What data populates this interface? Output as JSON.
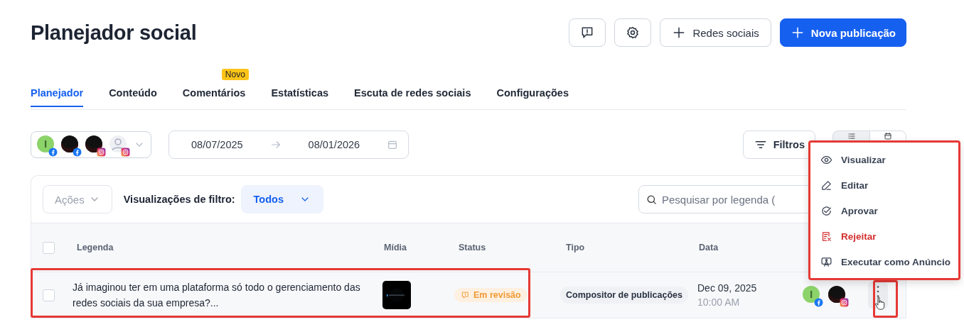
{
  "page": {
    "title": "Planejador social"
  },
  "header_buttons": [
    {
      "kind": "feedback"
    },
    {
      "kind": "settings"
    },
    {
      "kind": "outline",
      "label": "Redes sociais"
    },
    {
      "kind": "primary",
      "label": "Nova publicação"
    }
  ],
  "tabs": [
    {
      "label": "Planejador",
      "selected": true
    },
    {
      "label": "Conteúdo",
      "selected": false
    },
    {
      "label": "Comentários",
      "selected": false,
      "badge": "Novo"
    },
    {
      "label": "Estatísticas",
      "selected": false
    },
    {
      "label": "Escuta de redes sociais",
      "selected": false
    },
    {
      "label": "Configurações",
      "selected": false
    }
  ],
  "accounts": [
    {
      "kind": "letter",
      "badge": {
        "kind": "facebook"
      }
    },
    {
      "kind": "dark",
      "badge": {
        "kind": "facebook"
      }
    },
    {
      "kind": "dark",
      "badge": {
        "kind": "instagram"
      }
    },
    {
      "kind": "person",
      "badge": {
        "kind": "instagram"
      }
    }
  ],
  "date_range": {
    "start": "08/07/2025",
    "end": "08/01/2026"
  },
  "filters_button": "Filtros",
  "view_toggle": [
    {
      "kind": "list",
      "selected": true
    },
    {
      "kind": "calendar",
      "selected": false
    }
  ],
  "toolbar": {
    "actions": {
      "label": "Ações",
      "disabled": true
    },
    "filter_views_label": "Visualizações de filtro:",
    "filter_view": "Todos",
    "search": {
      "placeholder": "Pesquisar por legenda ("
    }
  },
  "table": {
    "select_all": {
      "checked": false
    },
    "columns": [
      "Legenda",
      "Mídia",
      "Status",
      "Tipo",
      "Data"
    ],
    "rows": [
      {
        "checked": false,
        "caption": "Já imaginou ter em uma plataforma só todo o gerenciamento das redes sociais da sua empresa?...",
        "status": "Em revisão",
        "type": "Compositor de publicações",
        "date": "Dec 09, 2025",
        "time": "10:00 AM",
        "networks": [
          {
            "kind": "letter",
            "badge": {
              "kind": "facebook"
            }
          },
          {
            "kind": "dark",
            "badge": {
              "kind": "instagram"
            }
          }
        ]
      }
    ]
  },
  "context_menu": [
    {
      "kind": "view",
      "label": "Visualizar",
      "danger": false
    },
    {
      "kind": "edit",
      "label": "Editar",
      "danger": false
    },
    {
      "kind": "approve",
      "label": "Aprovar",
      "danger": false
    },
    {
      "kind": "reject",
      "label": "Rejeitar",
      "danger": true
    },
    {
      "kind": "ad",
      "label": "Executar como Anúncio",
      "danger": false
    }
  ]
}
